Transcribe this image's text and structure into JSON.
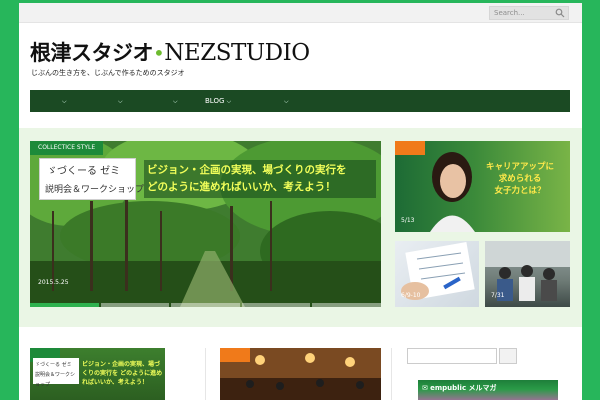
{
  "search": {
    "placeholder": "Search..."
  },
  "site": {
    "logo_jp": "根津スタジオ",
    "logo_en": "NEZSTUDIO",
    "tagline": "じぶんの生き方を、じぶんで作るためのスタジオ"
  },
  "nav": {
    "items": [
      {
        "label": ""
      },
      {
        "label": ""
      },
      {
        "label": ""
      },
      {
        "label": "BLOG"
      },
      {
        "label": ""
      }
    ]
  },
  "featured": {
    "tag": "COLLECTICE STYLE",
    "logo_line1": "ゞづくーる ゼミ",
    "logo_line2": "説明会＆ワークショップ",
    "headline_line1": "ビジョン・企画の実現、場づくりの実行を",
    "headline_line2": "どのように進めればいいか、考えよう！",
    "date": "2015.5.25"
  },
  "tiles": [
    {
      "label": "5/13",
      "text_line1": "キャリアアップに",
      "text_line2": "求められる",
      "text_line3": "女子力とは？"
    },
    {
      "label": "6/9-10"
    },
    {
      "label": "7/31"
    }
  ],
  "lower": {
    "card1_logo": "ゞづくーる ゼミ 説明会＆ワークショップ",
    "card1_head": "ビジョン・企画の実現、場づくりの実行を どのように進めればいいか、考えよう！",
    "banner": "empublic メルマガ"
  },
  "colors": {
    "accent": "#27b65b",
    "nav_bg": "#1b4a23",
    "badge_orange": "#f07a1a"
  }
}
